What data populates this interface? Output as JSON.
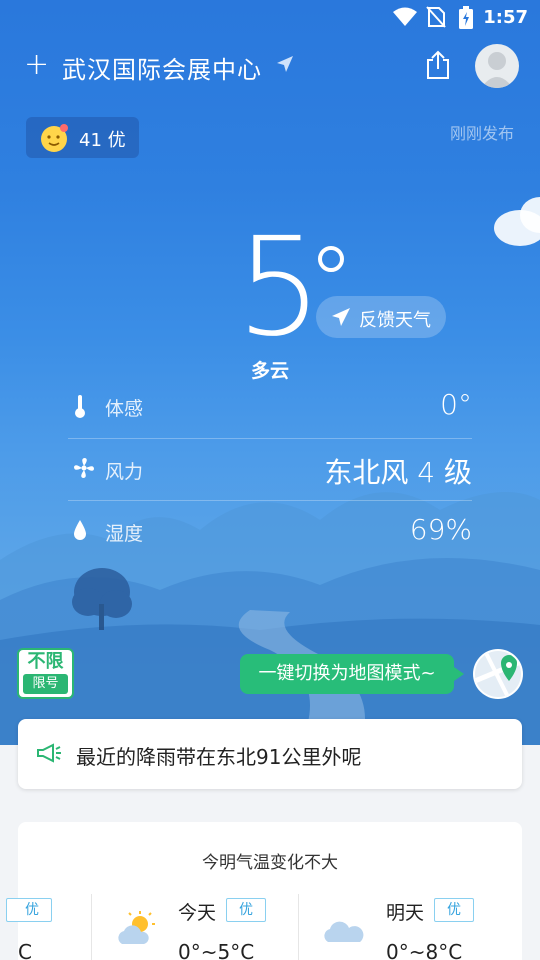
{
  "status_bar": {
    "time": "1:57"
  },
  "header": {
    "location": "武汉国际会展中心"
  },
  "aqi": {
    "value": "41",
    "level": "优"
  },
  "published": "刚刚发布",
  "current": {
    "temperature": "5",
    "condition": "多云",
    "feedback_label": "反馈天气"
  },
  "details": [
    {
      "label": "体感",
      "value": "0°",
      "icon": "thermometer-icon"
    },
    {
      "label": "风力",
      "value": "东北风 4 级",
      "icon": "fan-icon"
    },
    {
      "label": "湿度",
      "value": "69%",
      "icon": "drop-icon"
    }
  ],
  "traffic_limit": {
    "top": "不限",
    "bottom": "限号"
  },
  "map_switch": {
    "label": "一键切换为地图模式~"
  },
  "rain_notice": {
    "text": "最近的降雨带在东北91公里外呢",
    "icon": "megaphone-icon"
  },
  "forecast": {
    "title": "今明气温变化不大",
    "partial": {
      "badge": "优",
      "temp": "C"
    },
    "days": [
      {
        "day": "今天",
        "badge": "优",
        "range": "0°~5°C",
        "icon": "partly-cloudy-icon"
      },
      {
        "day": "明天",
        "badge": "优",
        "range": "0°~8°C",
        "icon": "cloudy-icon"
      }
    ]
  },
  "colors": {
    "accent_green": "#28bd79",
    "sky_top": "#2a78dc",
    "badge_blue": "#35a3de"
  }
}
